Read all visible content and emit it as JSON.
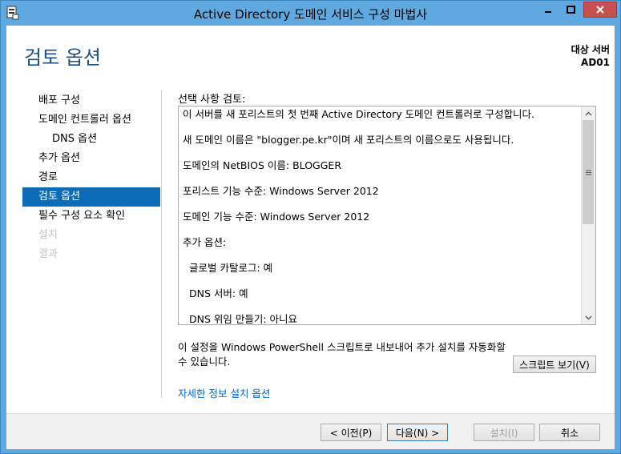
{
  "window": {
    "title": "Active Directory 도메인 서비스 구성 마법사"
  },
  "header": {
    "page_title": "검토 옵션",
    "target_label": "대상 서버",
    "target_server": "AD01"
  },
  "nav": {
    "items": [
      {
        "label": "배포 구성",
        "state": "normal",
        "indent": false
      },
      {
        "label": "도메인 컨트롤러 옵션",
        "state": "normal",
        "indent": false
      },
      {
        "label": "DNS 옵션",
        "state": "normal",
        "indent": true
      },
      {
        "label": "추가 옵션",
        "state": "normal",
        "indent": false
      },
      {
        "label": "경로",
        "state": "normal",
        "indent": false
      },
      {
        "label": "검토 옵션",
        "state": "selected",
        "indent": false
      },
      {
        "label": "필수 구성 요소 확인",
        "state": "normal",
        "indent": false
      },
      {
        "label": "설치",
        "state": "disabled",
        "indent": false
      },
      {
        "label": "결과",
        "state": "disabled",
        "indent": false
      }
    ]
  },
  "review": {
    "label": "선택 사항 검토:",
    "lines": [
      {
        "text": "이 서버를 새 포리스트의 첫 번째 Active Directory 도메인 컨트롤러로 구성합니다.",
        "indent": false
      },
      {
        "text": "새 도메인 이름은 \"blogger.pe.kr\"이며 새 포리스트의 이름으로도 사용됩니다.",
        "indent": false
      },
      {
        "text": "도메인의 NetBIOS 이름: BLOGGER",
        "indent": false
      },
      {
        "text": "포리스트 기능 수준: Windows Server 2012",
        "indent": false
      },
      {
        "text": "도메인 기능 수준: Windows Server 2012",
        "indent": false
      },
      {
        "text": "추가 옵션:",
        "indent": false
      },
      {
        "text": "글로벌 카탈로그: 예",
        "indent": true
      },
      {
        "text": "DNS 서버: 예",
        "indent": true
      },
      {
        "text": "DNS 위임 만들기: 아니요",
        "indent": true
      }
    ]
  },
  "powershell": {
    "text_line1": "이 설정을 Windows PowerShell 스크립트로 내보내어 추가 설치를 자동화할",
    "text_line2": "수 있습니다.",
    "script_button": "스크립트 보기(V)"
  },
  "more_link": "자세한 정보 설치 옵션",
  "footer": {
    "prev": "< 이전(P)",
    "next": "다음(N) >",
    "install": "설치(I)",
    "cancel": "취소"
  },
  "colors": {
    "title_bar": "#5fa9e0",
    "page_title": "#1e4e79",
    "nav_selected": "#0c6cb8",
    "close_button": "#c75050",
    "link": "#0066cc"
  }
}
